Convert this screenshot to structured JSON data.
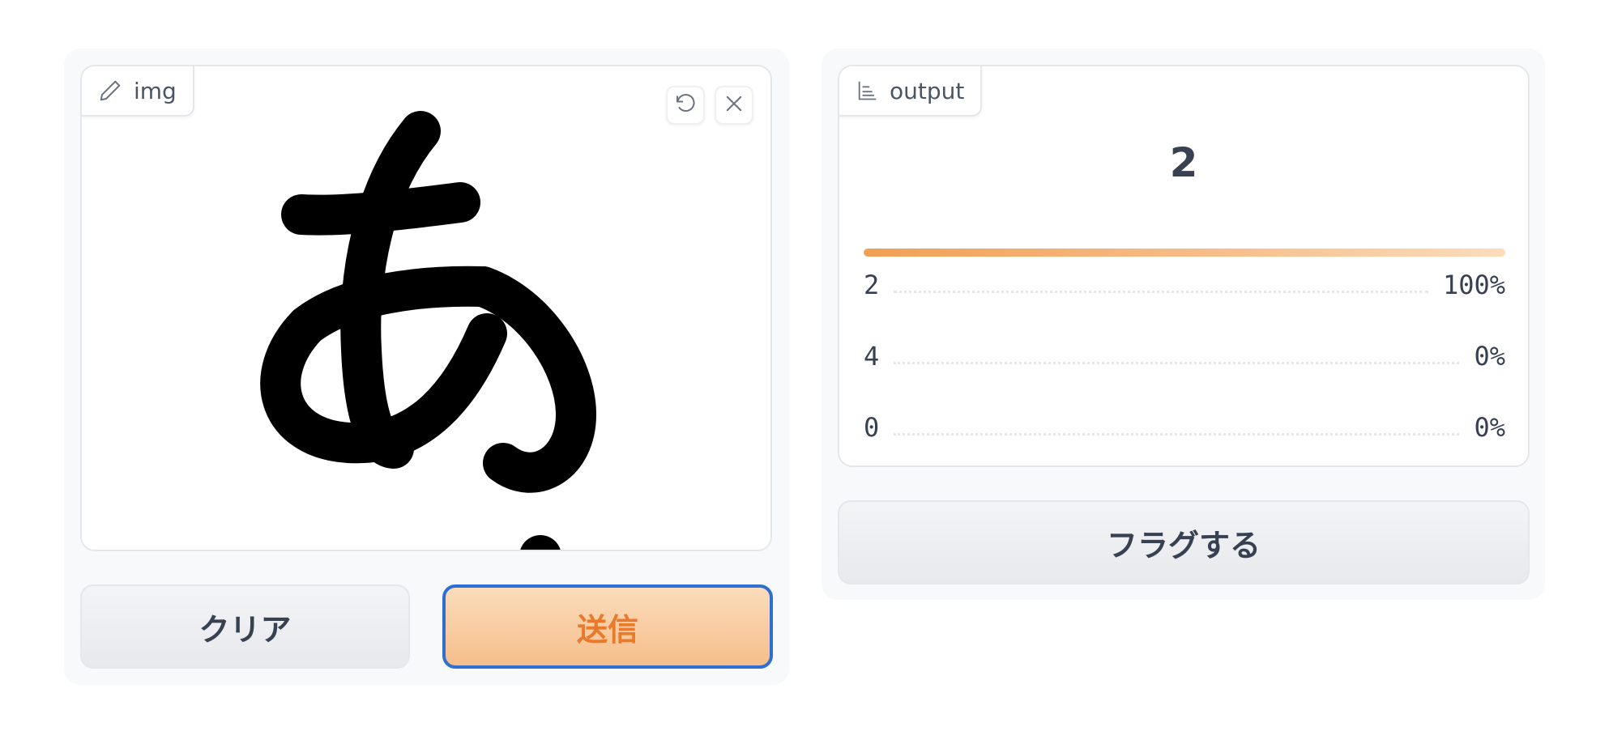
{
  "image_input": {
    "label": "img",
    "label_icon": "pencil-icon",
    "tools": [
      {
        "name": "undo",
        "icon": "undo-icon"
      },
      {
        "name": "clear",
        "icon": "close-icon"
      }
    ],
    "drawing": "handwritten hiragana character in black ink"
  },
  "buttons": {
    "clear_label": "クリア",
    "submit_label": "送信",
    "flag_label": "フラグする"
  },
  "output": {
    "label": "output",
    "label_icon": "bar-chart-icon",
    "top_label": "2",
    "top_confidence": 1.0,
    "confidences": [
      {
        "label": "2",
        "value": "100%"
      },
      {
        "label": "4",
        "value": "0%"
      },
      {
        "label": "0",
        "value": "0%"
      }
    ]
  },
  "colors": {
    "primary_accent": "#ea7a2b",
    "primary_bg": "#f6be8b",
    "focus_border": "#2f6fd1",
    "panel_bg": "#f8f9fb",
    "ink": "#000000"
  }
}
